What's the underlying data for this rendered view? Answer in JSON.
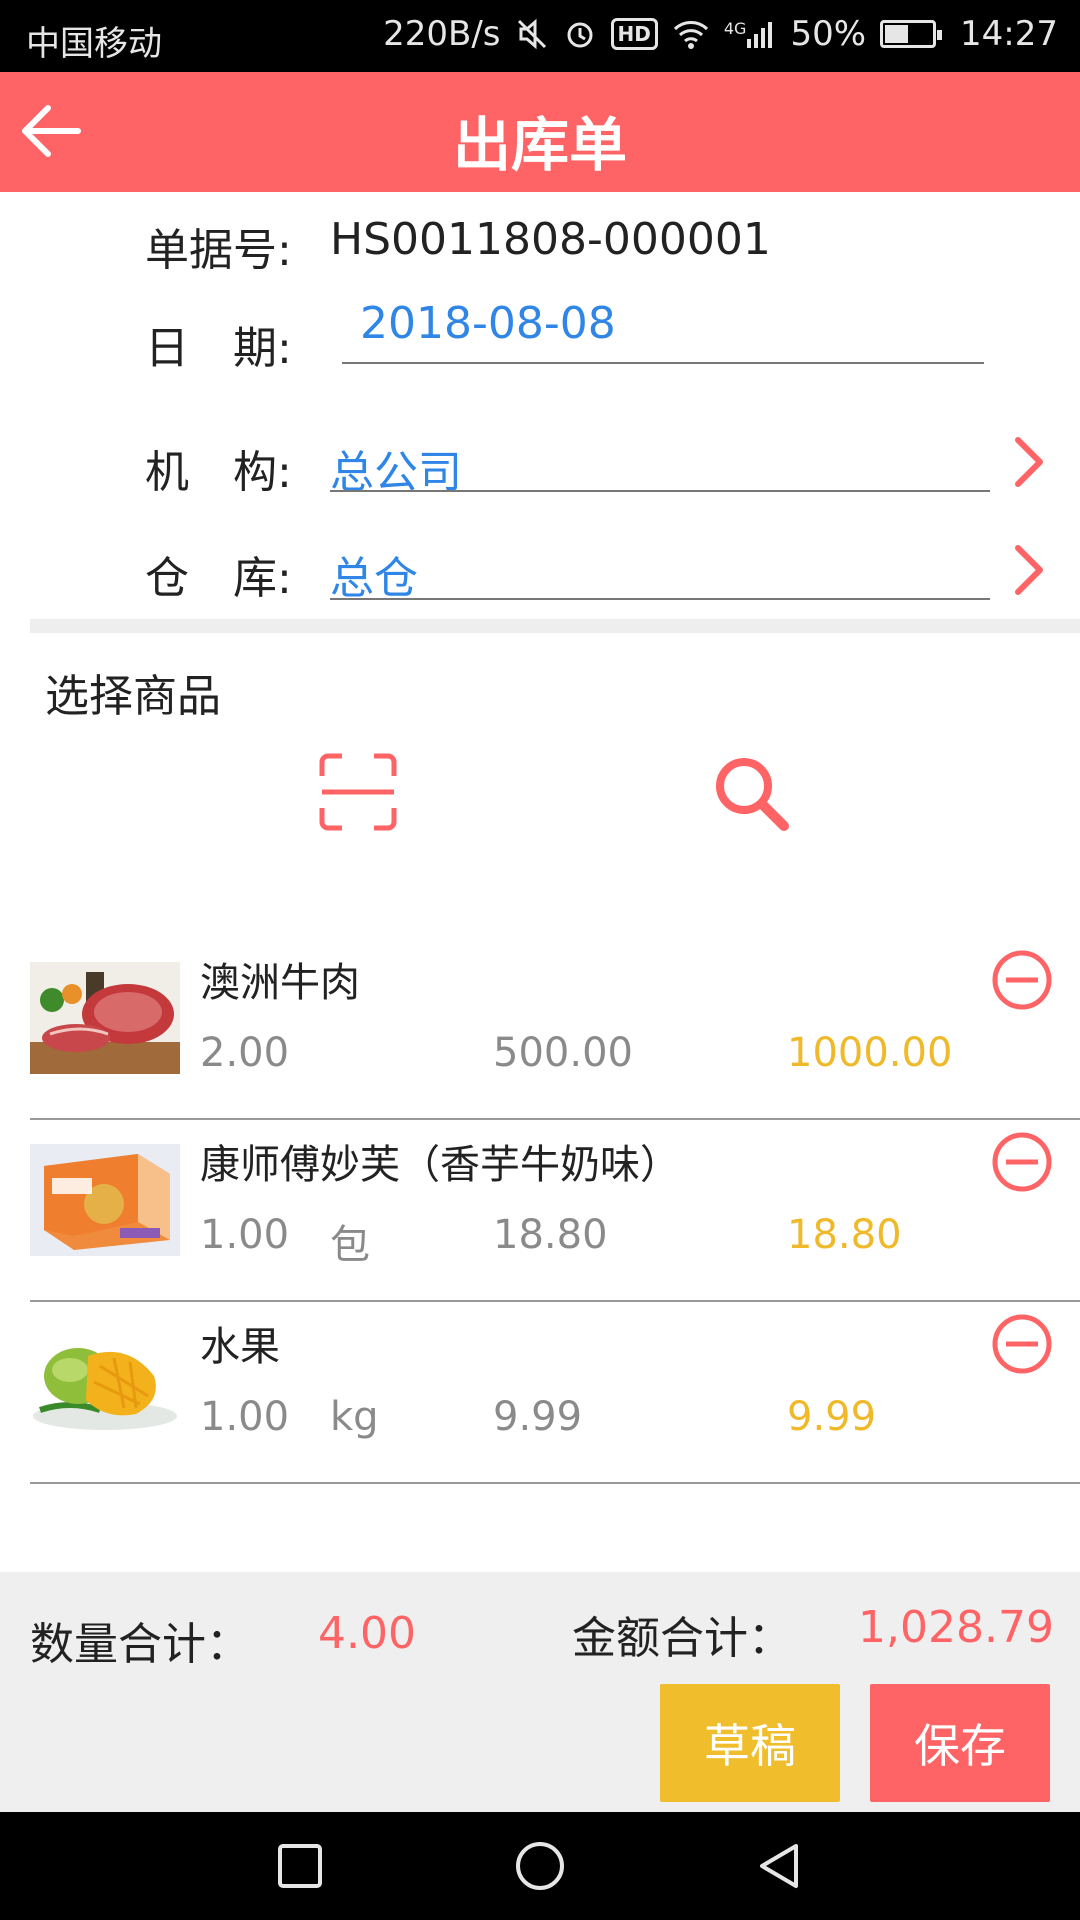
{
  "status_bar": {
    "carrier": "中国移动",
    "speed": "220B/s",
    "hd": "HD",
    "network": "4G",
    "battery": "50%",
    "battery_level": 0.5,
    "time": "14:27"
  },
  "header": {
    "title": "出库单"
  },
  "form": {
    "doc_no_label": "单据号:",
    "doc_no": "HS0011808-000001",
    "date_label": "日　期:",
    "date": "2018-08-08",
    "org_label": "机　构:",
    "org": "总公司",
    "warehouse_label": "仓　库:",
    "warehouse": "总仓"
  },
  "select_goods": {
    "title": "选择商品"
  },
  "products": [
    {
      "name": "澳洲牛肉",
      "qty": "2.00",
      "unit": "",
      "price": "500.00",
      "amount": "1000.00",
      "image": "beef"
    },
    {
      "name": "康师傅妙芙（香芋牛奶味）",
      "qty": "1.00",
      "unit": "包",
      "price": "18.80",
      "amount": "18.80",
      "image": "cake-box"
    },
    {
      "name": "水果",
      "qty": "1.00",
      "unit": "kg",
      "price": "9.99",
      "amount": "9.99",
      "image": "mango"
    }
  ],
  "footer": {
    "qty_total_label": "数量合计：",
    "qty_total": "4.00",
    "amount_total_label": "金额合计：",
    "amount_total": "1,028.79",
    "draft_label": "草稿",
    "save_label": "保存"
  },
  "colors": {
    "brand": "#fe6465",
    "link": "#2f86e6",
    "amount": "#f0b92a",
    "draft": "#f0bd2d"
  }
}
